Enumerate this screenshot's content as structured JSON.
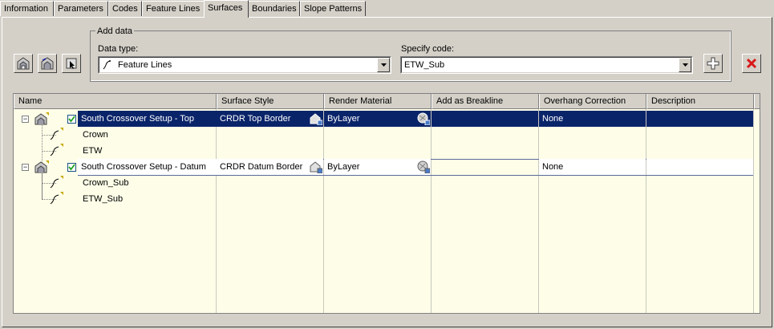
{
  "tabs": [
    {
      "label": "Information",
      "active": false
    },
    {
      "label": "Parameters",
      "active": false
    },
    {
      "label": "Codes",
      "active": false
    },
    {
      "label": "Feature Lines",
      "active": false
    },
    {
      "label": "Surfaces",
      "active": true
    },
    {
      "label": "Boundaries",
      "active": false
    },
    {
      "label": "Slope Patterns",
      "active": false
    }
  ],
  "add_data": {
    "group_label": "Add data",
    "data_type_label": "Data type:",
    "data_type_value": "Feature Lines",
    "specify_code_label": "Specify code:",
    "specify_code_value": "ETW_Sub"
  },
  "grid": {
    "columns": [
      "Name",
      "Surface Style",
      "Render Material",
      "Add as Breakline",
      "Overhang Correction",
      "Description"
    ],
    "rows": [
      {
        "name": "South Crossover Setup - Top",
        "style": "CRDR Top Border",
        "material": "ByLayer",
        "breakline": "",
        "overhang": "None",
        "description": "",
        "selected": true
      },
      {
        "name": "Crown"
      },
      {
        "name": "ETW"
      },
      {
        "name": "South Crossover Setup - Datum",
        "style": "CRDR Datum Border",
        "material": "ByLayer",
        "breakline": "",
        "overhang": "None",
        "description": "",
        "selected": false
      },
      {
        "name": "Crown_Sub"
      },
      {
        "name": "ETW_Sub"
      }
    ]
  },
  "icons": {
    "add": "plus-icon",
    "delete": "red-x-icon",
    "expander_collapse": "−"
  },
  "colors": {
    "selection": "#0a246a",
    "grid_background": "#fefee8",
    "dialog": "#d4d0c8",
    "delete_red": "#d81818"
  }
}
